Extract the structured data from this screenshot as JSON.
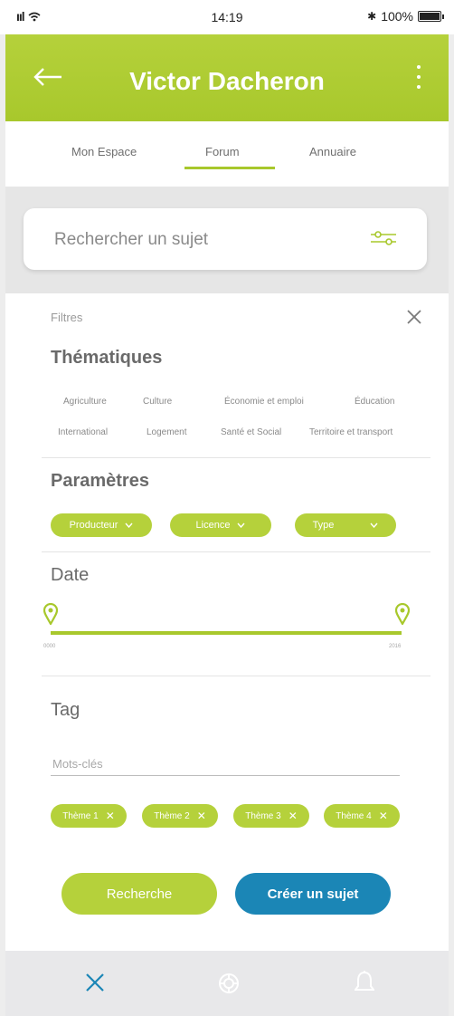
{
  "status_bar": {
    "signal": "ııl",
    "wifi_icon": "wifi-icon",
    "time": "14:19",
    "bluetooth": "✱",
    "battery": "100%"
  },
  "header": {
    "title": "Victor Dacheron",
    "back_icon": "arrow-left-icon",
    "menu_icon": "more-vertical-icon"
  },
  "tabs": [
    {
      "label": "Mon Espace"
    },
    {
      "label": "Forum",
      "active": true
    },
    {
      "label": "Annuaire"
    }
  ],
  "search": {
    "placeholder": "Rechercher un sujet",
    "filter_icon": "sliders-icon"
  },
  "filters": {
    "label": "Filtres",
    "close_icon": "close-icon",
    "thematiques": {
      "title": "Thématiques",
      "items": [
        "Agriculture",
        "Culture",
        "Économie et emploi",
        "Éducation",
        "International",
        "Logement",
        "Santé et Social",
        "Territoire et transport"
      ]
    },
    "parametres": {
      "title": "Paramètres",
      "dropdowns": [
        "Producteur",
        "Licence",
        "Type"
      ]
    },
    "date": {
      "title": "Date",
      "range_start": "0000",
      "range_end": "2016"
    },
    "tag": {
      "title": "Tag",
      "placeholder": "Mots-clés",
      "chips": [
        "Thème 1",
        "Thème 2",
        "Thème 3",
        "Thème 4"
      ]
    }
  },
  "actions": {
    "search_label": "Recherche",
    "create_label": "Créer un sujet"
  },
  "bottom_nav": {
    "items": [
      "close-icon",
      "lifebuoy-icon",
      "bell-icon"
    ]
  },
  "colors": {
    "accent_green": "#b5d13b",
    "accent_blue": "#1b86b6"
  }
}
